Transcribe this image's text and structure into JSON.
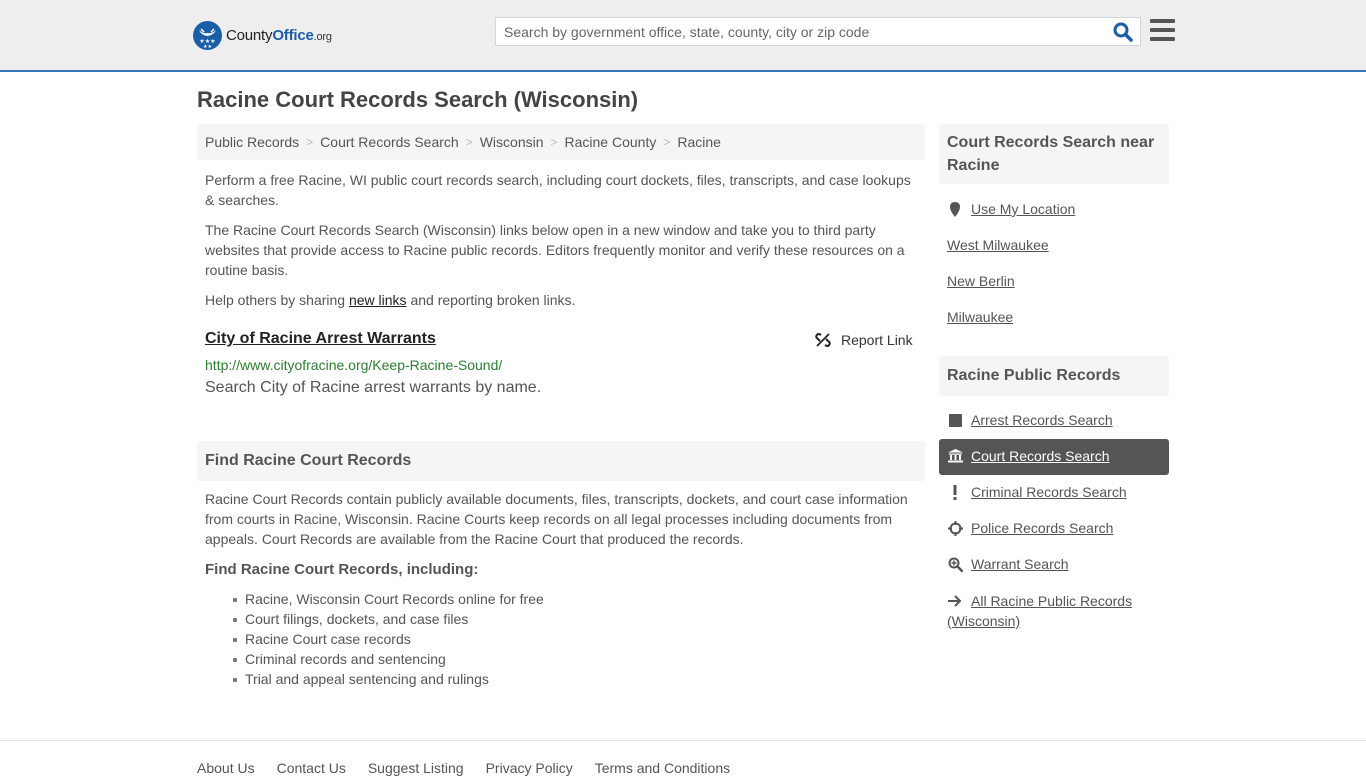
{
  "header": {
    "logo": {
      "text_main": "County",
      "text_office": "Office",
      "text_org": ".org"
    },
    "search": {
      "placeholder": "Search by government office, state, county, city or zip code",
      "value": ""
    },
    "icons": {
      "search": "search-icon",
      "menu": "hamburger-menu-icon"
    },
    "accent_color": "#337ab7"
  },
  "page": {
    "title": "Racine Court Records Search (Wisconsin)"
  },
  "breadcrumb": [
    {
      "label": "Public Records"
    },
    {
      "label": "Court Records Search"
    },
    {
      "label": "Wisconsin"
    },
    {
      "label": "Racine County"
    },
    {
      "label": "Racine"
    }
  ],
  "intro": {
    "p1": "Perform a free Racine, WI public court records search, including court dockets, files, transcripts, and case lookups & searches.",
    "p2": "The Racine Court Records Search (Wisconsin) links below open in a new window and take you to third party websites that provide access to Racine public records. Editors frequently monitor and verify these resources on a routine basis.",
    "p3_before": "Help others by sharing ",
    "p3_link": "new links",
    "p3_after": " and reporting broken links."
  },
  "results": [
    {
      "title": "City of Racine Arrest Warrants",
      "url": "http://www.cityofracine.org/Keep-Racine-Sound/",
      "description": "Search City of Racine arrest warrants by name.",
      "report_label": "Report Link"
    }
  ],
  "find_section": {
    "heading": "Find Racine Court Records",
    "text": "Racine Court Records contain publicly available documents, files, transcripts, dockets, and court case information from courts in Racine, Wisconsin. Racine Courts keep records on all legal processes including documents from appeals. Court Records are available from the Racine Court that produced the records.",
    "subheading": "Find Racine Court Records, including:",
    "items": [
      "Racine, Wisconsin Court Records online for free",
      "Court filings, dockets, and case files",
      "Racine Court case records",
      "Criminal records and sentencing",
      "Trial and appeal sentencing and rulings"
    ]
  },
  "sidebar": {
    "nearby": {
      "heading": "Court Records Search near Racine",
      "use_location": "Use My Location",
      "cities": [
        "West Milwaukee",
        "New Berlin",
        "Milwaukee"
      ]
    },
    "public_records": {
      "heading": "Racine Public Records",
      "items": [
        {
          "label": "Arrest Records Search",
          "icon": "square-icon",
          "active": false
        },
        {
          "label": "Court Records Search",
          "icon": "courthouse-icon",
          "active": true
        },
        {
          "label": "Criminal Records Search",
          "icon": "exclamation-icon",
          "active": false
        },
        {
          "label": "Police Records Search",
          "icon": "crosshair-icon",
          "active": false
        },
        {
          "label": "Warrant Search",
          "icon": "zoom-in-icon",
          "active": false
        },
        {
          "label": "All Racine Public Records (Wisconsin)",
          "icon": "arrow-right-icon",
          "active": false
        }
      ]
    }
  },
  "footer": {
    "links": [
      "About Us",
      "Contact Us",
      "Suggest Listing",
      "Privacy Policy",
      "Terms and Conditions"
    ]
  }
}
